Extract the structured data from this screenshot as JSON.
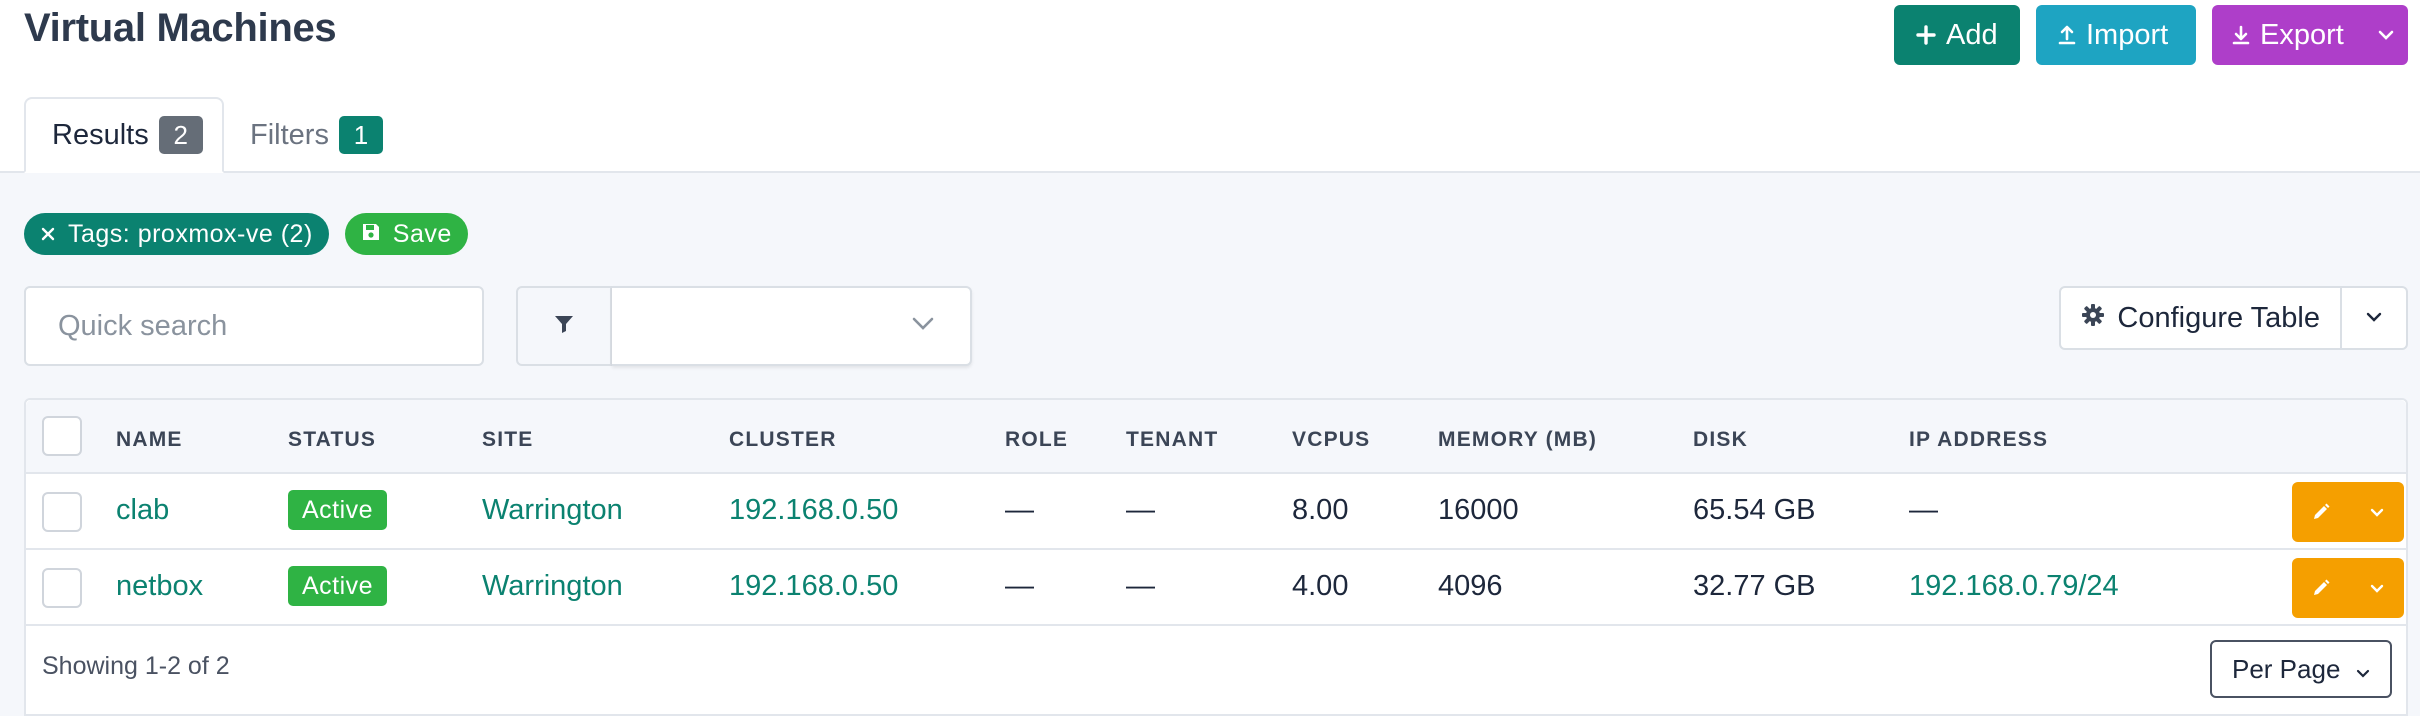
{
  "page": {
    "title": "Virtual Machines"
  },
  "actions": {
    "add_label": "Add",
    "import_label": "Import",
    "export_label": "Export"
  },
  "tabs": [
    {
      "label": "Results",
      "count": "2"
    },
    {
      "label": "Filters",
      "count": "1"
    }
  ],
  "filters": {
    "active_tag": "Tags: proxmox-ve (2)",
    "save_label": "Save"
  },
  "search": {
    "placeholder": "Quick search"
  },
  "configure_table_label": "Configure Table",
  "table": {
    "columns": [
      "Name",
      "Status",
      "Site",
      "Cluster",
      "Role",
      "Tenant",
      "vCPUs",
      "Memory (MB)",
      "Disk",
      "IP Address"
    ],
    "rows": [
      {
        "name": "clab",
        "status": "Active",
        "site": "Warrington",
        "cluster": "192.168.0.50",
        "role": "—",
        "tenant": "—",
        "vcpus": "8.00",
        "memory": "16000",
        "disk": "65.54 GB",
        "ip": "—"
      },
      {
        "name": "netbox",
        "status": "Active",
        "site": "Warrington",
        "cluster": "192.168.0.50",
        "role": "—",
        "tenant": "—",
        "vcpus": "4.00",
        "memory": "4096",
        "disk": "32.77 GB",
        "ip": "192.168.0.79/24"
      }
    ]
  },
  "footer": {
    "showing": "Showing 1-2 of 2",
    "per_page_label": "Per Page"
  },
  "colors": {
    "primary": "#0b8270",
    "import": "#1ea4c2",
    "export": "#ae3ec9",
    "success": "#2fb344",
    "warning": "#f59f00"
  },
  "icons": {
    "add": "plus-icon",
    "import": "upload-icon",
    "export": "download-icon",
    "remove_filter": "close-icon",
    "save": "floppy-disk-icon",
    "filter": "funnel-icon",
    "configure": "gear-icon",
    "edit": "pencil-icon",
    "dropdown": "chevron-down-icon"
  }
}
